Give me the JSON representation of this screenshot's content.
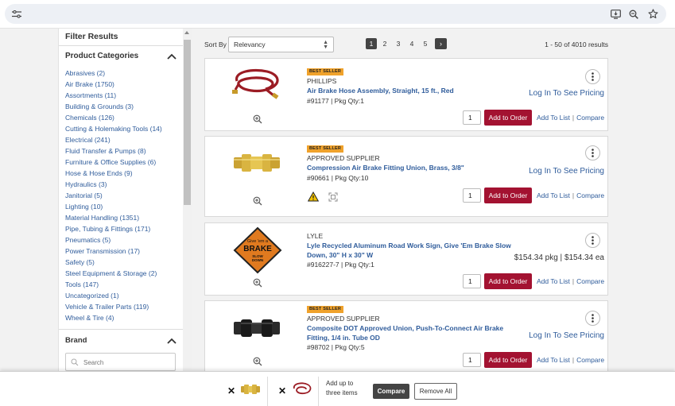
{
  "filters": {
    "title": "Filter Results",
    "categories_title": "Product Categories",
    "categories": [
      "Abrasives (2)",
      "Air Brake (1750)",
      "Assortments (11)",
      "Building & Grounds (3)",
      "Chemicals (126)",
      "Cutting & Holemaking Tools (14)",
      "Electrical (241)",
      "Fluid Transfer & Pumps (8)",
      "Furniture & Office Supplies (6)",
      "Hose & Hose Ends (9)",
      "Hydraulics (3)",
      "Janitorial (5)",
      "Lighting (10)",
      "Material Handling (1351)",
      "Pipe, Tubing & Fittings (171)",
      "Pneumatics (5)",
      "Power Transmission (17)",
      "Safety (5)",
      "Steel Equipment & Storage (2)",
      "Tools (147)",
      "Uncategorized (1)",
      "Vehicle & Trailer Parts (119)",
      "Wheel & Tire (4)"
    ],
    "brand_title": "Brand",
    "search_placeholder": "Search"
  },
  "sort": {
    "label": "Sort By",
    "value": "Relevancy"
  },
  "pagination": {
    "pages": [
      "1",
      "2",
      "3",
      "4",
      "5"
    ],
    "current": "1",
    "next": "›"
  },
  "result_count": "1 - 50 of 4010 results",
  "products": [
    {
      "badge": "BEST SELLER",
      "brand": "PHILLIPS",
      "name": "Air Brake Hose Assembly, Straight, 15 ft., Red",
      "sku": "#91177 | Pkg Qty:1",
      "pricing": "Log In To See Pricing",
      "qty": "1",
      "add_label": "Add to Order",
      "add_to_list": "Add To List",
      "compare": "Compare"
    },
    {
      "badge": "BEST SELLER",
      "brand": "APPROVED SUPPLIER",
      "name": "Compression Air Brake Fitting Union, Brass, 3/8\"",
      "sku": "#90661 | Pkg Qty:10",
      "pricing": "Log In To See Pricing",
      "qty": "1",
      "add_label": "Add to Order",
      "add_to_list": "Add To List",
      "compare": "Compare"
    },
    {
      "badge": "",
      "brand": "LYLE",
      "name": "Lyle Recycled Aluminum Road Work Sign, Give 'Em Brake Slow Down, 30\" H x 30\" W",
      "sku": "#916227-7 | Pkg Qty:1",
      "pricing": "$154.34 pkg | $154.34 ea",
      "qty": "1",
      "add_label": "Add to Order",
      "add_to_list": "Add To List",
      "compare": "Compare",
      "sign_text": [
        "Give 'em a",
        "BRAKE",
        "SLOW",
        "DOWN"
      ]
    },
    {
      "badge": "BEST SELLER",
      "brand": "APPROVED SUPPLIER",
      "name": "Composite DOT Approved Union, Push-To-Connect Air Brake Fitting, 1/4 in. Tube OD",
      "sku": "#98702 | Pkg Qty:5",
      "pricing": "Log In To See Pricing",
      "qty": "1",
      "add_label": "Add to Order",
      "add_to_list": "Add To List",
      "compare": "Compare"
    }
  ],
  "compare_bar": {
    "text": "Add up to three items",
    "compare_label": "Compare",
    "remove_label": "Remove All",
    "remove_symbol": "✕"
  },
  "colors": {
    "accent": "#a31231",
    "link": "#2f5c9b",
    "badge": "#f0a22b"
  }
}
